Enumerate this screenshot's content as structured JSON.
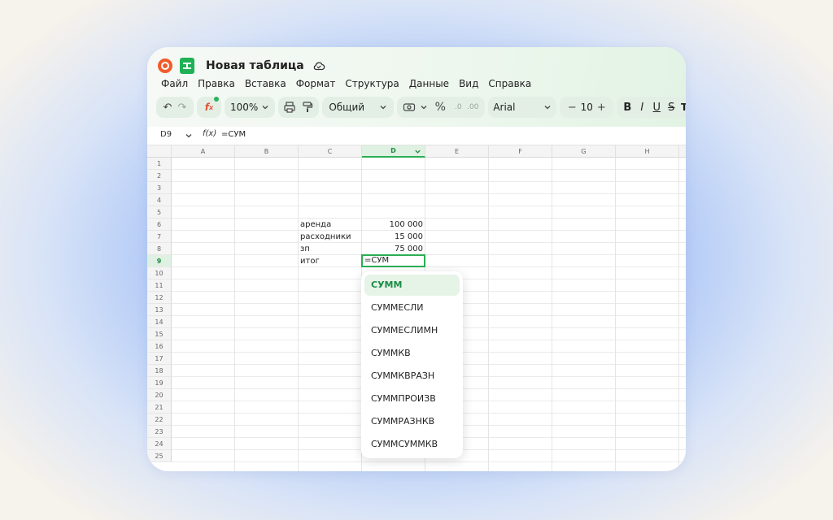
{
  "app": {
    "title": "Новая таблица"
  },
  "menu": [
    "Файл",
    "Правка",
    "Вставка",
    "Формат",
    "Структура",
    "Данные",
    "Вид",
    "Справка"
  ],
  "toolbar": {
    "zoom": "100%",
    "number_format": "Общий",
    "percent": "%",
    "font": "Arial",
    "font_size": "10",
    "minus": "−",
    "plus": "+",
    "bold": "B",
    "italic": "I",
    "underline": "U",
    "strike": "S",
    "text_style": "TI",
    "fx": "f",
    "accent_color": "#2aae55"
  },
  "formula_bar": {
    "cell_ref": "D9",
    "fx_label": "f(x)",
    "formula": "=СУМ"
  },
  "columns": [
    "A",
    "B",
    "C",
    "D",
    "E",
    "F",
    "G",
    "H"
  ],
  "active_column": "D",
  "rows": [
    "1",
    "2",
    "3",
    "4",
    "5",
    "6",
    "7",
    "8",
    "9",
    "10",
    "11",
    "12",
    "13",
    "14",
    "15",
    "16",
    "17",
    "18",
    "19",
    "20",
    "21",
    "22",
    "23",
    "24",
    "25"
  ],
  "active_row": "9",
  "cells": {
    "C6": "аренда",
    "D6": "100 000",
    "C7": "расходники",
    "D7": "15 000",
    "C8": "зп",
    "D8": "75 000",
    "C9": "итог",
    "D9": "=СУМ"
  },
  "autocomplete": [
    "СУММ",
    "СУММЕСЛИ",
    "СУММЕСЛИМН",
    "СУММКВ",
    "СУММКВРАЗН",
    "СУММПРОИЗВ",
    "СУММРАЗНКВ",
    "СУММСУММКВ"
  ],
  "autocomplete_selected": "СУММ"
}
